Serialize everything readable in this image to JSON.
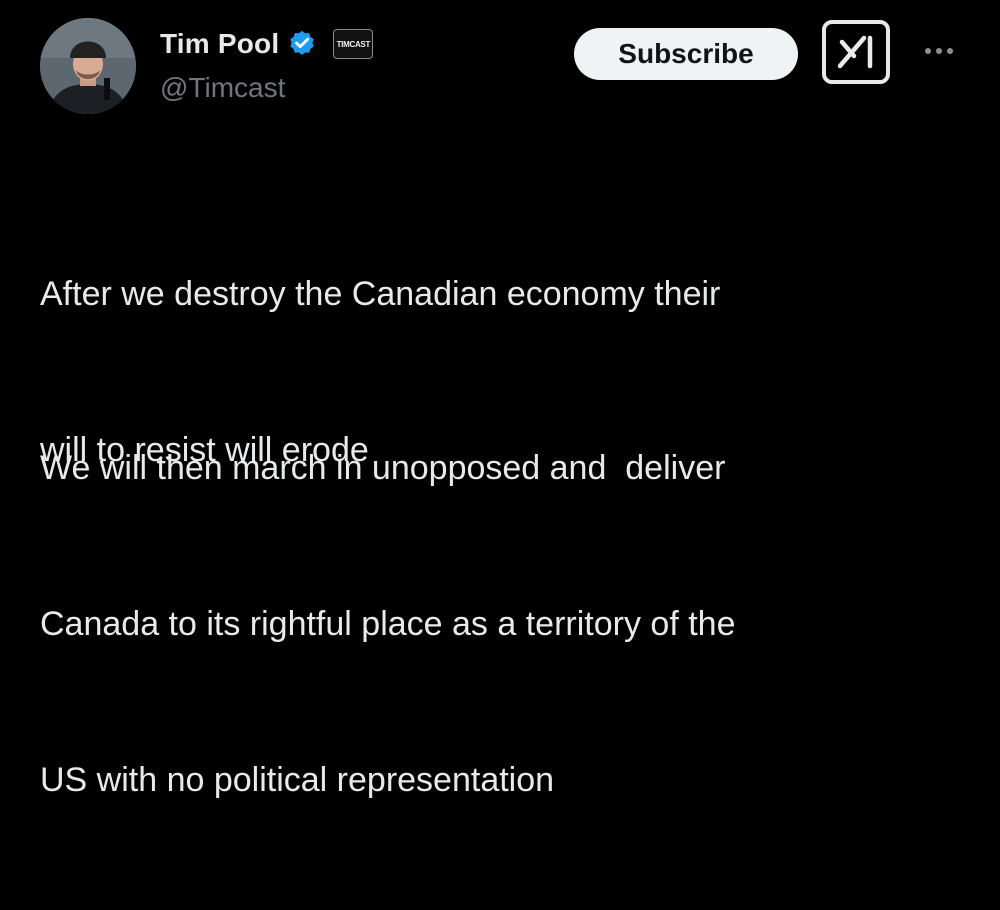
{
  "author": {
    "display_name": "Tim Pool",
    "handle": "@Timcast",
    "affiliate_badge": "TIMCAST",
    "avatar": "avatar-photo",
    "verified_icon": "verified-check-icon",
    "verified_color": "#1d9bf0"
  },
  "actions": {
    "subscribe_label": "Subscribe",
    "grok_icon": "grok-icon",
    "more_icon": "more-dots-icon"
  },
  "post": {
    "paragraph1": [
      "After we destroy the Canadian economy their",
      "will to resist will erode"
    ],
    "paragraph2": [
      "We will then march in unopposed and  deliver",
      "Canada to its rightful place as a territory of the",
      "US with no political representation"
    ]
  },
  "colors": {
    "background": "#000000",
    "text_primary": "#e7e9ea",
    "text_secondary": "#71767b",
    "button_bg": "#eff3f4"
  }
}
